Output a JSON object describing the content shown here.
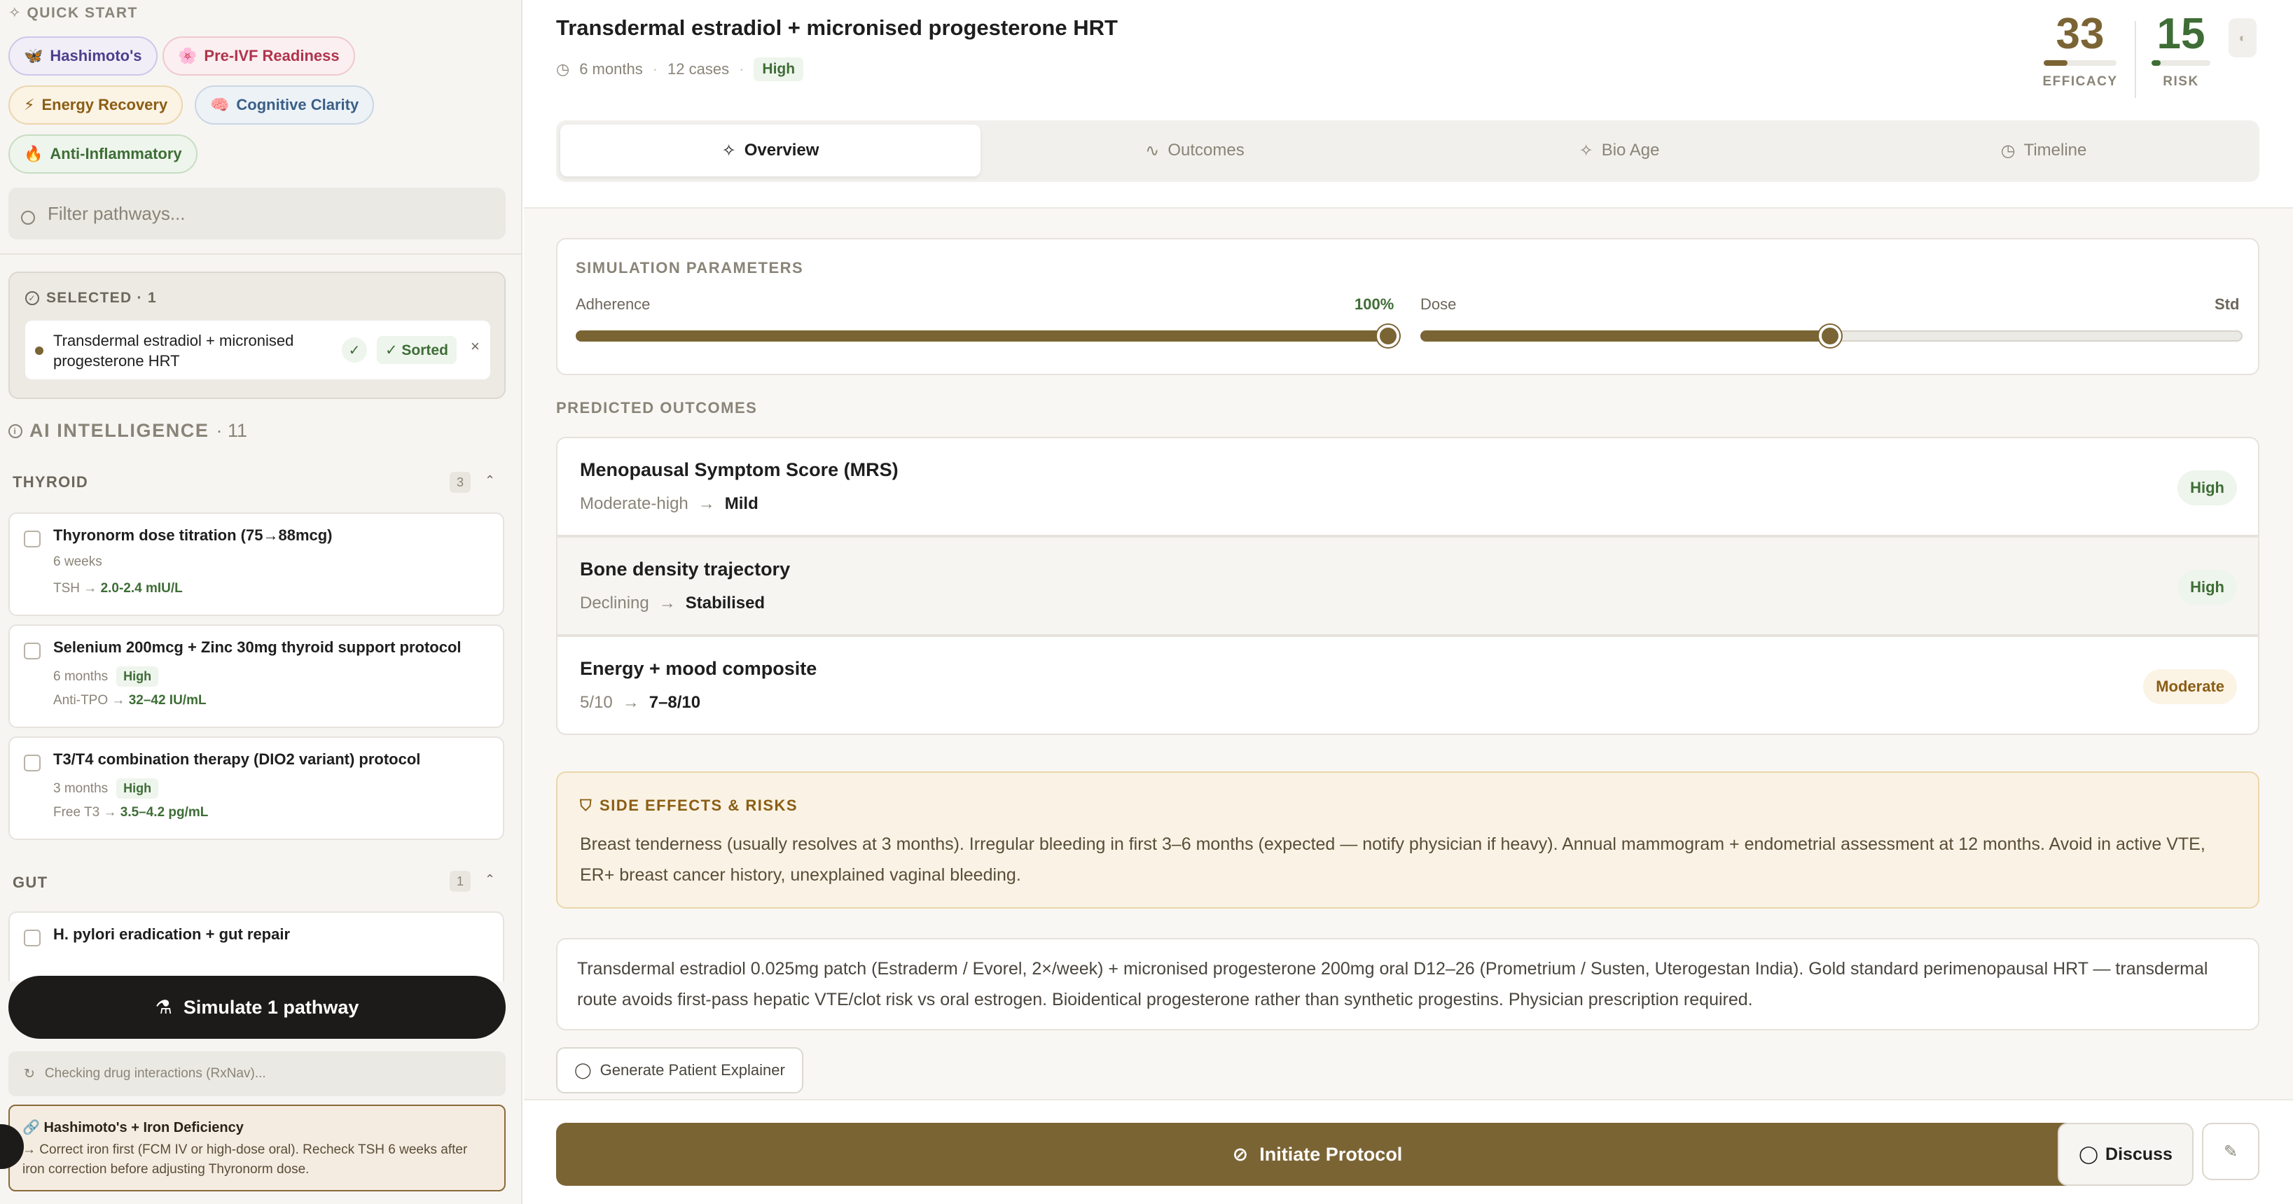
{
  "sidebar": {
    "quick_start_label": "QUICK START",
    "chips": [
      {
        "icon": "🦋",
        "label": "Hashimoto's"
      },
      {
        "icon": "🌸",
        "label": "Pre-IVF Readiness"
      },
      {
        "icon": "⚡",
        "label": "Energy Recovery"
      },
      {
        "icon": "🧠",
        "label": "Cognitive Clarity"
      },
      {
        "icon": "🔥",
        "label": "Anti-Inflammatory"
      }
    ],
    "filter_placeholder": "Filter pathways...",
    "selected": {
      "heading": "SELECTED · 1",
      "item_title": "Transdermal estradiol + micronised progesterone HRT",
      "check_icon": "✓",
      "sorted_label": "✓ Sorted",
      "close_icon": "×"
    },
    "ai": {
      "label": "AI INTELLIGENCE",
      "count": "· 11"
    },
    "categories": [
      {
        "name": "THYROID",
        "count": "3",
        "chevron": "⌃"
      },
      {
        "name": "GUT",
        "count": "1",
        "chevron": "⌃"
      }
    ],
    "pathways": [
      {
        "title": "Thyronorm dose titration (75→88mcg)",
        "duration": "6 weeks",
        "badge": "",
        "target_label": "TSH →",
        "target_value": "2.0-2.4 mIU/L"
      },
      {
        "title": "Selenium 200mcg + Zinc 30mg thyroid support protocol",
        "duration": "6 months",
        "badge": "High",
        "target_label": "Anti-TPO →",
        "target_value": "32–42 IU/mL"
      },
      {
        "title": "T3/T4 combination therapy (DIO2 variant) protocol",
        "duration": "3 months",
        "badge": "High",
        "target_label": "Free T3 →",
        "target_value": "3.5–4.2 pg/mL"
      },
      {
        "title": "H. pylori eradication + gut repair",
        "duration": "",
        "badge": "",
        "target_label": "",
        "target_value": ""
      }
    ],
    "simulate_label": "Simulate 1 pathway",
    "checking_label": "Checking drug interactions (RxNav)...",
    "alert": {
      "title": "🔗 Hashimoto's + Iron Deficiency",
      "body": "→ Correct iron first (FCM IV or high-dose oral). Recheck TSH 6 weeks after iron correction before adjusting Thyronorm dose."
    }
  },
  "main": {
    "title": "Transdermal estradiol + micronised progesterone HRT",
    "meta": {
      "duration": "6 months",
      "cases": "12 cases",
      "level": "High"
    },
    "scores": [
      {
        "value": "33",
        "label": "EFFICACY",
        "fraction": 0.33,
        "color": "#7b6434"
      },
      {
        "value": "15",
        "label": "RISK",
        "fraction": 0.15,
        "color": "#3e6d36"
      }
    ],
    "tabs": [
      {
        "icon": "✧",
        "label": "Overview"
      },
      {
        "icon": "∿",
        "label": "Outcomes"
      },
      {
        "icon": "✧",
        "label": "Bio Age"
      },
      {
        "icon": "◷",
        "label": "Timeline"
      }
    ],
    "sim_params": {
      "label": "SIMULATION PARAMETERS",
      "adherence_label": "Adherence",
      "adherence_value": "100%",
      "adherence_fraction": 1.0,
      "dose_label": "Dose",
      "dose_value": "Std",
      "dose_fraction": 0.5
    },
    "outcomes_label": "PREDICTED OUTCOMES",
    "outcomes": [
      {
        "name": "Menopausal Symptom Score (MRS)",
        "from": "Moderate-high",
        "to": "Mild",
        "badge": "High"
      },
      {
        "name": "Bone density trajectory",
        "from": "Declining",
        "to": "Stabilised",
        "badge": "High"
      },
      {
        "name": "Energy + mood composite",
        "from": "5/10",
        "to": "7–8/10",
        "badge": "Moderate"
      }
    ],
    "side_effects": {
      "title": "SIDE EFFECTS & RISKS",
      "body": "Breast tenderness (usually resolves at 3 months). Irregular bleeding in first 3–6 months (expected — notify physician if heavy). Annual mammogram + endometrial assessment at 12 months. Avoid in active VTE, ER+ breast cancer history, unexplained vaginal bleeding."
    },
    "description": "Transdermal estradiol 0.025mg patch (Estraderm / Evorel, 2×/week) + micronised progesterone 200mg oral D12–26 (Prometrium / Susten, Uterogestan India). Gold standard perimenopausal HRT — transdermal route avoids first-pass hepatic VTE/clot risk vs oral estrogen. Bioidentical progesterone rather than synthetic progestins. Physician prescription required.",
    "explainer_label": "Generate Patient Explainer",
    "initiate_label": "Initiate Protocol",
    "discuss_label": "Discuss"
  }
}
